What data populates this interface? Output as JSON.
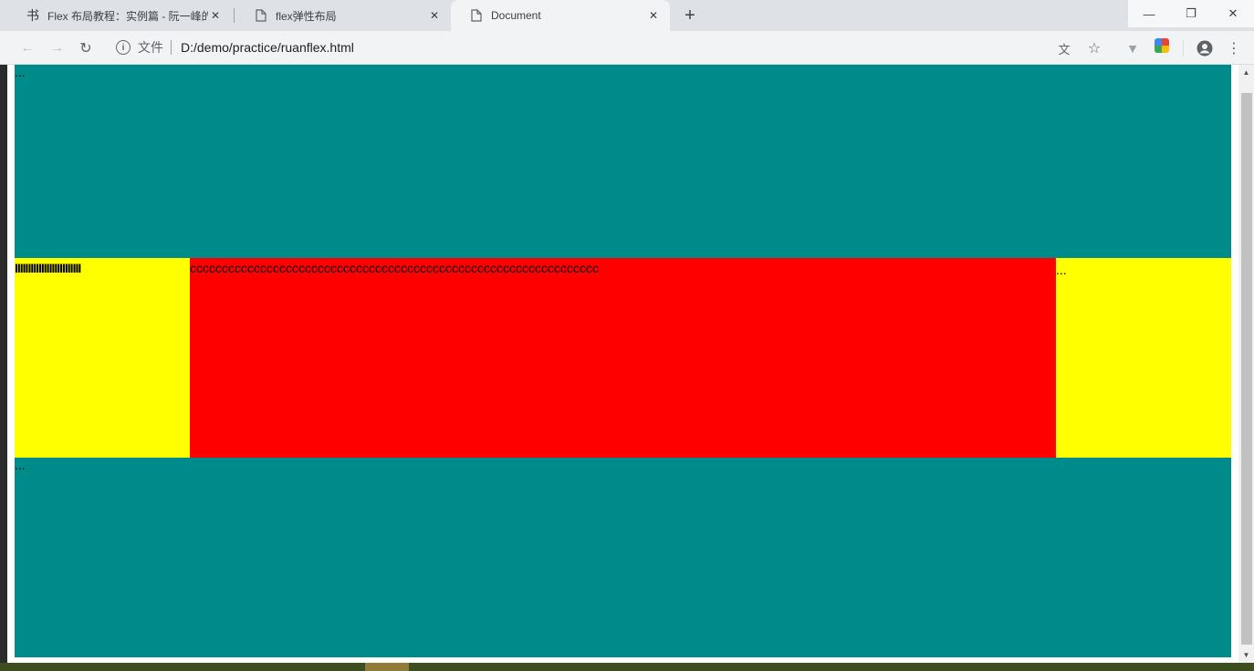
{
  "tabs": [
    {
      "title": "Flex 布局教程：实例篇 - 阮一峰的",
      "favicon": "ruanyf-logo-icon",
      "active": false
    },
    {
      "title": "flex弹性布局",
      "favicon": "page-icon",
      "active": false
    },
    {
      "title": "Document",
      "favicon": "page-icon",
      "active": true
    }
  ],
  "address": {
    "scheme_label": "文件",
    "url": "D:/demo/practice/ruanflex.html"
  },
  "content": {
    "top_text": "...",
    "left_text": "IIIIIIIIIIIIIIIIIIIIIIIII",
    "center_text": "cccccccccccccccccccccccccccccccccccccccccccccccccccccccccccccccc",
    "right_text": "...",
    "bottom_text": "..."
  },
  "colors": {
    "teal": "#008b8b",
    "yellow": "#ffff00",
    "red": "#ff0000"
  }
}
